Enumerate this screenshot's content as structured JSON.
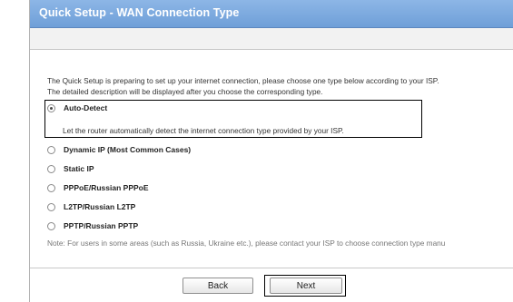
{
  "page": {
    "title": "Quick Setup - WAN Connection Type",
    "description_line1": "The Quick Setup is preparing to set up your internet connection, please choose one type below according to your ISP.",
    "description_line2": "The detailed description will be displayed after you choose the corresponding type."
  },
  "options": [
    {
      "label": "Auto-Detect",
      "selected": true,
      "detail": "Let the router automatically detect the internet connection type provided by your ISP."
    },
    {
      "label": "Dynamic IP (Most Common Cases)",
      "selected": false
    },
    {
      "label": "Static IP",
      "selected": false
    },
    {
      "label": "PPPoE/Russian PPPoE",
      "selected": false
    },
    {
      "label": "L2TP/Russian L2TP",
      "selected": false
    },
    {
      "label": "PPTP/Russian PPTP",
      "selected": false
    }
  ],
  "note": "Note: For users in some areas (such as Russia, Ukraine etc.), please contact your ISP to choose connection type manu",
  "buttons": {
    "back": "Back",
    "next": "Next"
  },
  "colors": {
    "header_bg": "#7ea9df",
    "header_text": "#ffffff",
    "highlight_border": "#000000"
  }
}
